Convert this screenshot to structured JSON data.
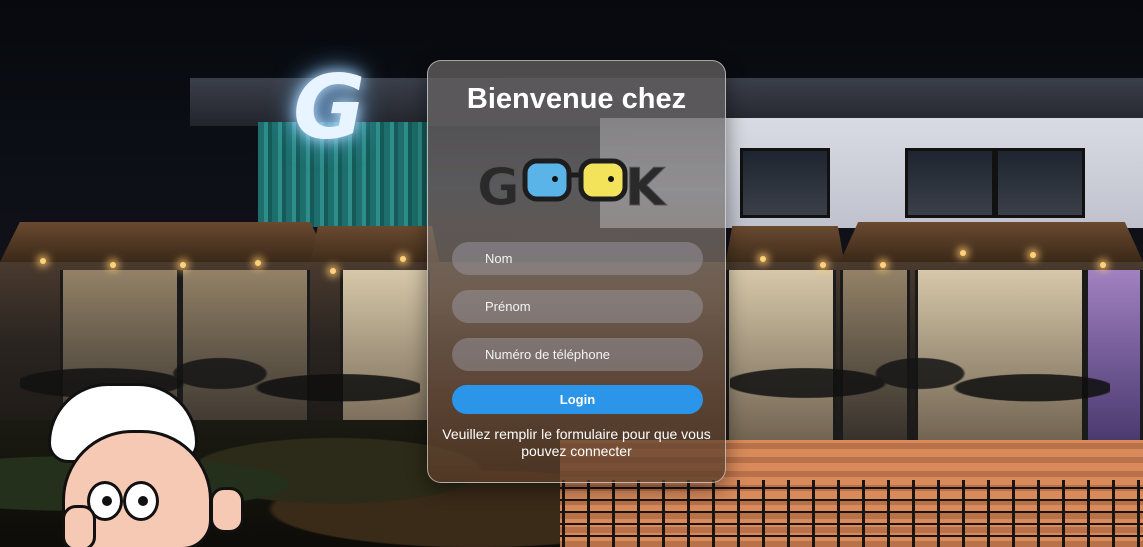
{
  "login": {
    "title": "Bienvenue chez",
    "logo_text": "GOOK",
    "fields": {
      "nom_placeholder": "Nom",
      "prenom_placeholder": "Prénom",
      "phone_placeholder": "Numéro de téléphone"
    },
    "button_label": "Login",
    "hint": "Veuillez remplir le formulaire pour que vous pouvez connecter"
  },
  "colors": {
    "button": "#2b95ea",
    "logo_left_lens": "#5ab4e8",
    "logo_right_lens": "#f2e35a"
  },
  "icons": {
    "background": "restaurant-photo",
    "mascot": "chef-mascot-icon"
  }
}
